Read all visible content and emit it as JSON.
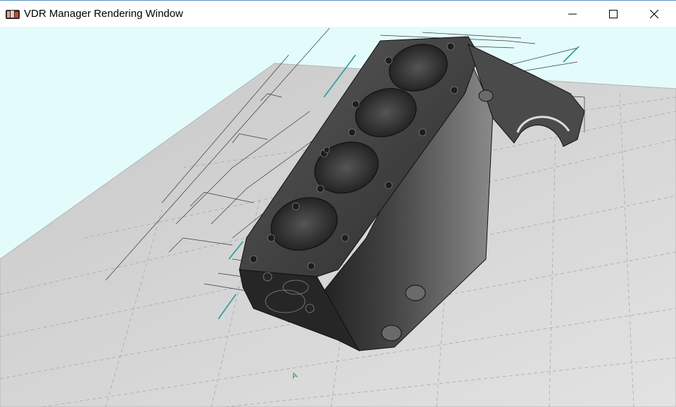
{
  "window": {
    "title": "VDR Manager Rendering Window",
    "controls": [
      "minimize",
      "maximize",
      "close"
    ]
  },
  "icons": {
    "app": "vdr-app-icon",
    "minimize": "minimize-icon",
    "maximize": "maximize-icon",
    "close": "close-icon"
  },
  "viewport": {
    "background": "#e3fbfb",
    "ground_color": "#d4d4d4",
    "model_color": "#3a3a3a",
    "annotation_color": "#2a9a9a",
    "marker_label": "A"
  }
}
